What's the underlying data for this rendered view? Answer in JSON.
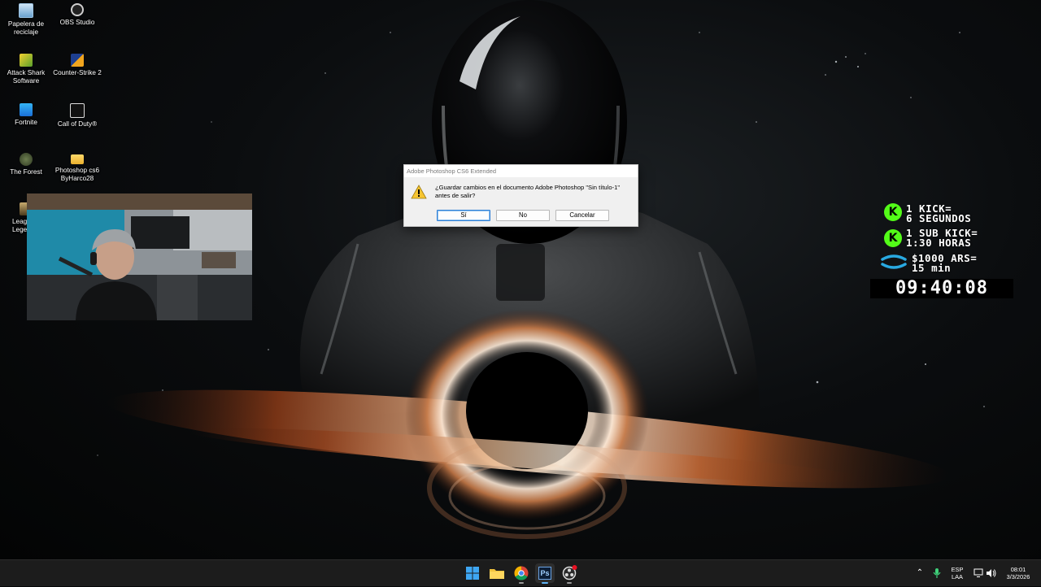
{
  "desktop": {
    "icons": [
      {
        "label": "Papelera de reciclaje",
        "icon": "recycle-bin-icon"
      },
      {
        "label": "OBS Studio",
        "icon": "obs-icon"
      },
      {
        "label": "Attack Shark Software",
        "icon": "attack-shark-icon"
      },
      {
        "label": "Counter-Strike 2",
        "icon": "counter-strike-icon"
      },
      {
        "label": "Fortnite",
        "icon": "fortnite-icon"
      },
      {
        "label": "Call of Duty®",
        "icon": "call-of-duty-icon"
      },
      {
        "label": "The Forest",
        "icon": "the-forest-icon"
      },
      {
        "label": "Photoshop cs6 ByHarco28",
        "icon": "folder-icon"
      },
      {
        "label": "Leag Lege",
        "icon": "league-icon"
      }
    ]
  },
  "dialog": {
    "title": "Adobe Photoshop CS6 Extended",
    "message": "¿Guardar cambios en el documento Adobe Photoshop \"Sin título-1\" antes de salir?",
    "buttons": {
      "yes": "Sí",
      "no": "No",
      "cancel": "Cancelar"
    }
  },
  "kick_overlay": {
    "rows": [
      {
        "line1": "1 KICK=",
        "line2": "6 SEGUNDOS",
        "icon": "kick-icon"
      },
      {
        "line1": "1 SUB KICK=",
        "line2": "1:30 HORAS",
        "icon": "kick-icon"
      },
      {
        "line1": "$1000 ARS=",
        "line2": "15 min",
        "icon": "cafecito-icon"
      }
    ],
    "timer": "09:40:08",
    "kick_color": "#53fc18"
  },
  "taskbar": {
    "apps": [
      "start-icon",
      "file-explorer-icon",
      "chrome-icon",
      "photoshop-icon",
      "obs-icon"
    ],
    "photoshop_label": "Ps",
    "language_top": "ESP",
    "language_bottom": "LAA",
    "time": "08:01",
    "date": "3/3/2026"
  }
}
